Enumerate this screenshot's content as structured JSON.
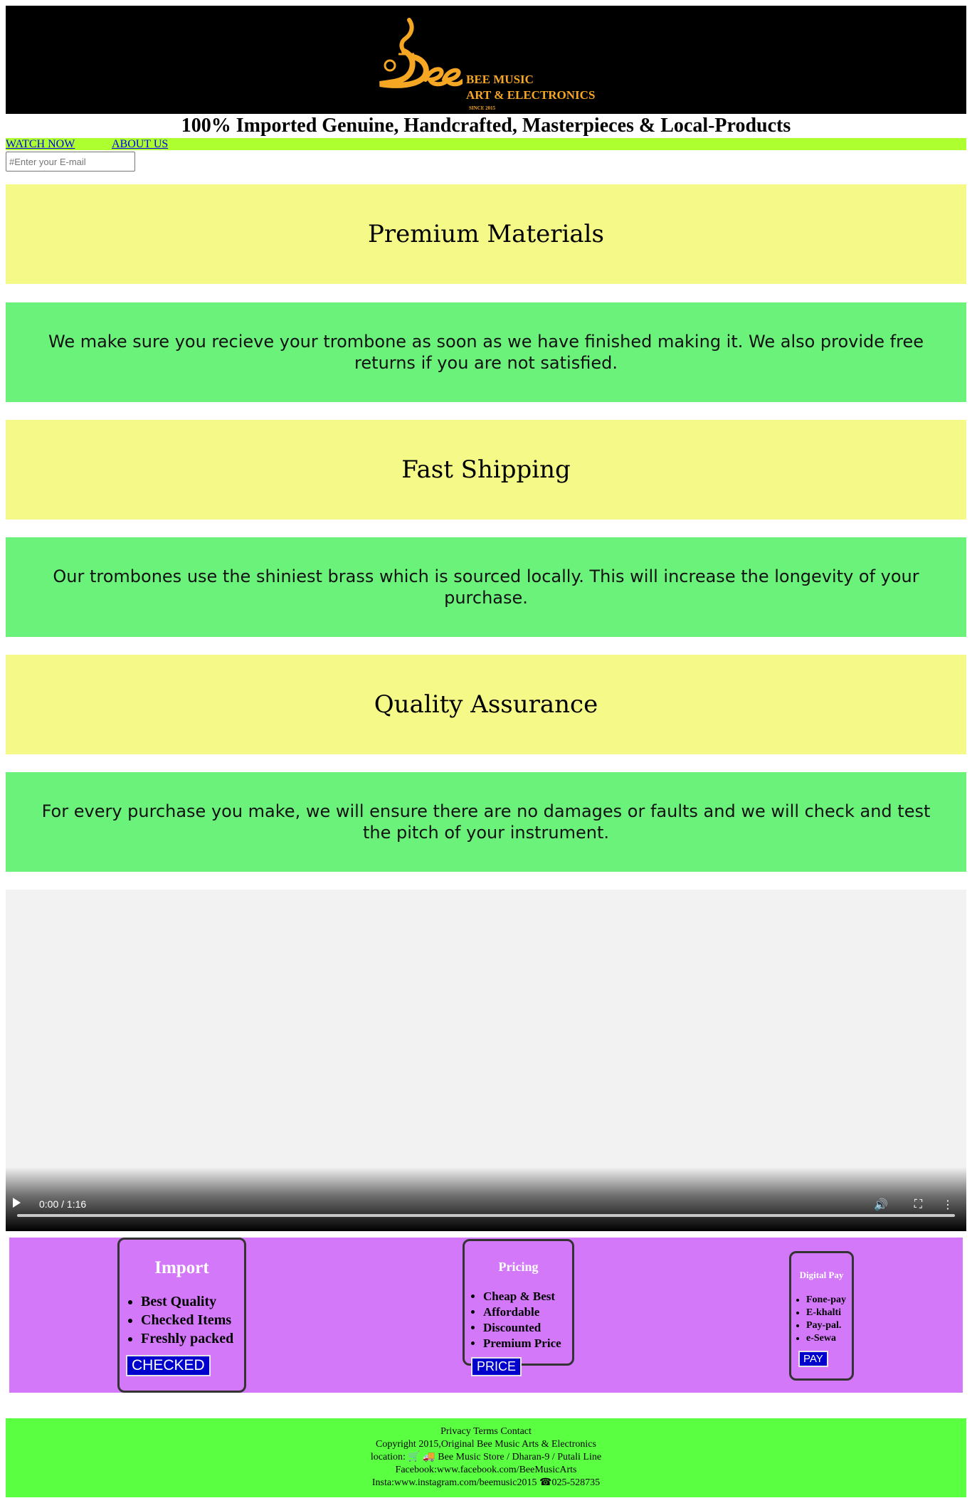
{
  "header": {
    "logo_mark": "Bee",
    "logo_line1": "BEE MUSIC",
    "logo_line2": "ART & ELECTRONICS",
    "logo_line3": "SINCE 2015",
    "logo_color": "#f5a623"
  },
  "tagline": "100% Imported Genuine, Handcrafted, Masterpieces & Local-Products",
  "nav": {
    "watch_now": "WATCH NOW",
    "about_us": "ABOUT US"
  },
  "email": {
    "placeholder": "#Enter your E-mail"
  },
  "sections": [
    {
      "heading": "Premium Materials"
    },
    {
      "text": "We make sure you recieve your trombone as soon as we have finished making it. We also provide free returns if you are not satisfied."
    },
    {
      "heading": "Fast Shipping"
    },
    {
      "text": "Our trombones use the shiniest brass which is sourced locally. This will increase the longevity of your purchase."
    },
    {
      "heading": "Quality Assurance"
    },
    {
      "text": "For every purchase you make, we will ensure there are no damages or faults and we will check and test the pitch of your instrument."
    }
  ],
  "video": {
    "time": "0:00 / 1:16",
    "progress": 0
  },
  "cards": {
    "import": {
      "title": "Import",
      "items": [
        "Best Quality",
        "Checked Items",
        "Freshly packed"
      ],
      "button": "CHECKED"
    },
    "pricing": {
      "title": "Pricing",
      "items": [
        "Cheap & Best",
        "Affordable",
        "Discounted",
        "Premium Price"
      ],
      "button": "PRICE"
    },
    "digital_pay": {
      "title": "Digital Pay",
      "items": [
        "Fone-pay",
        "E-khalti",
        "Pay-pal.",
        "e-Sewa"
      ],
      "button": "PAY"
    }
  },
  "footer": {
    "links": "Privacy Terms Contact",
    "copyright": "Copyright 2015,Original Bee Music Arts & Electronics",
    "location_label": "location:",
    "location": " Bee Music Store / Dharan-9 / Putali Line",
    "facebook": "Facebook:www.facebook.com/BeeMusicArts",
    "insta": "Insta:www.instagram.com/beemusic2015",
    "phone": "025-528735"
  },
  "colors": {
    "header_bg": "#000000",
    "nav_bg": "#adff2f",
    "heading_bg": "#f5f987",
    "text_bg": "#6bf27b",
    "features_bg": "#d378f9",
    "button_bg": "#0000cc",
    "footer_bg": "#5bff42"
  }
}
